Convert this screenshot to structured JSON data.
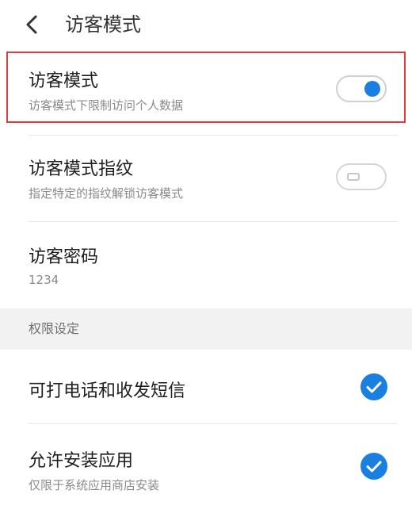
{
  "header": {
    "title": "访客模式",
    "back_icon": "chevron-left-icon"
  },
  "settings": {
    "guest_mode": {
      "title": "访客模式",
      "subtitle": "访客模式下限制访问个人数据",
      "enabled": true
    },
    "guest_fingerprint": {
      "title": "访客模式指纹",
      "subtitle": "指定特定的指纹解锁访客模式",
      "enabled": false
    },
    "guest_password": {
      "title": "访客密码",
      "value": "1234"
    }
  },
  "permissions": {
    "section_label": "权限设定",
    "items": [
      {
        "title": "可打电话和收发短信",
        "subtitle": "",
        "checked": true
      },
      {
        "title": "允许安装应用",
        "subtitle": "仅限于系统应用商店安装",
        "checked": true
      }
    ]
  },
  "colors": {
    "accent": "#1a7fe0",
    "highlight_border": "#e03c3c",
    "section_bg": "#f2f2f2"
  }
}
